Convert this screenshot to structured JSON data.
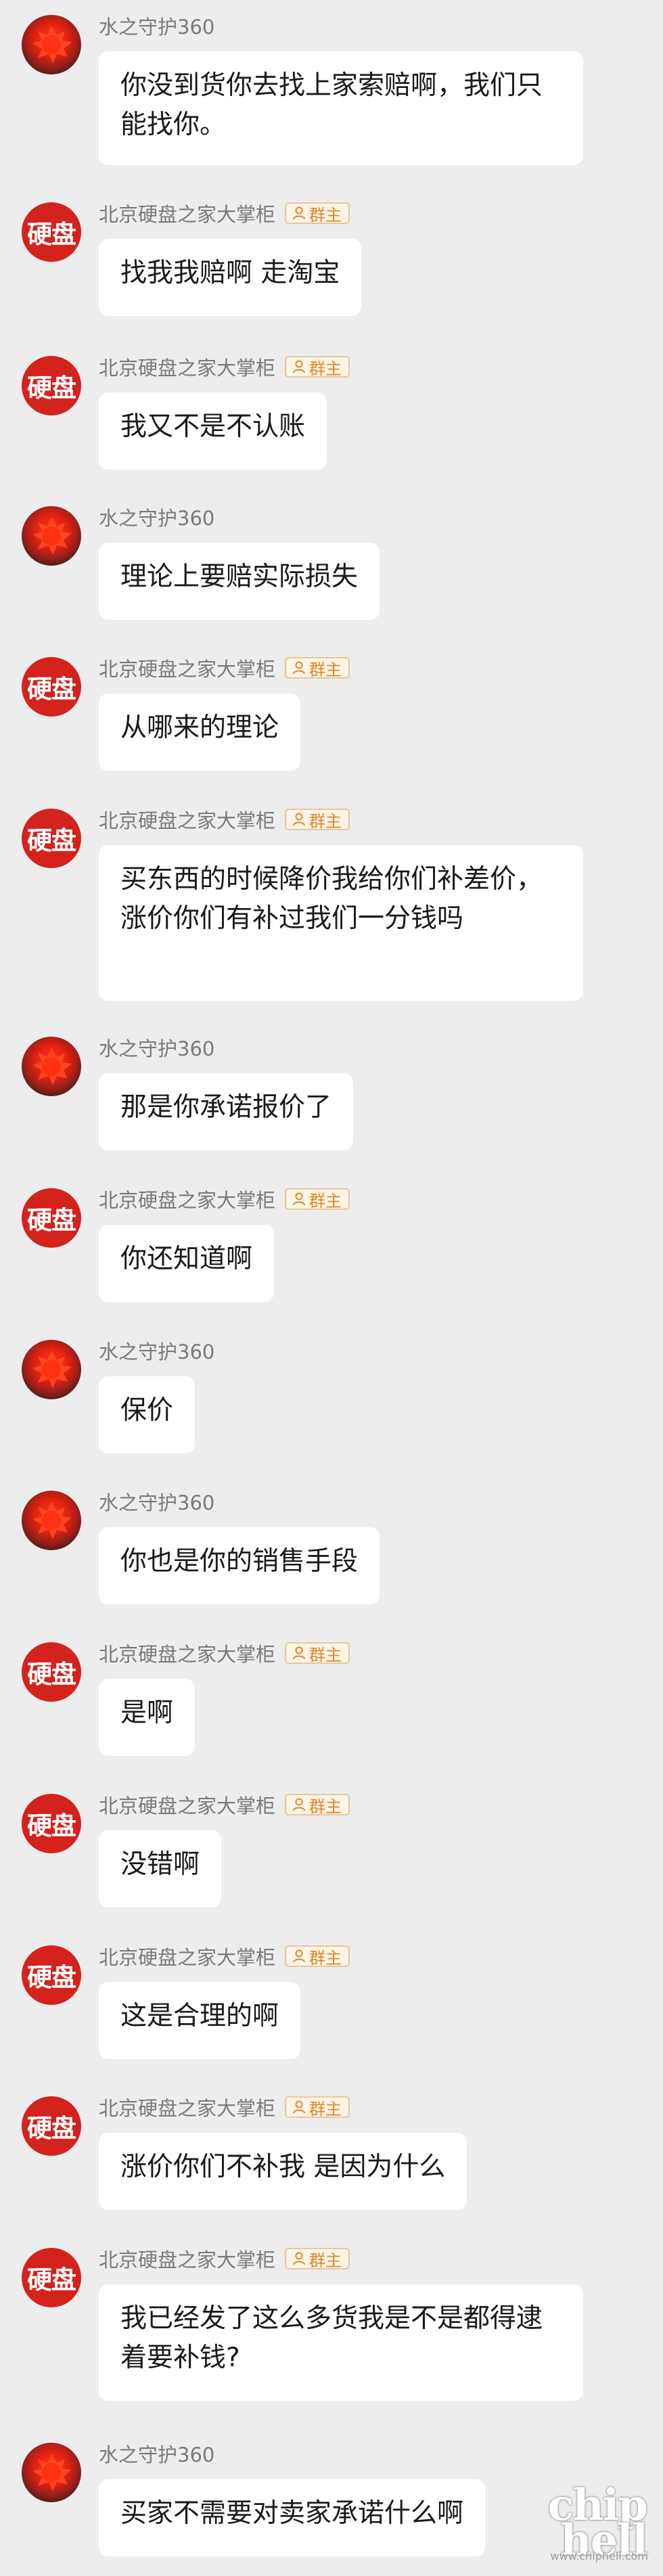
{
  "colors": {
    "background": "#ededed",
    "bubble": "#ffffff",
    "avatar_red": "#d4221d",
    "badge_text": "#d88a2b"
  },
  "users": {
    "water": {
      "name": "水之守护360",
      "avatar_icon": "red-leaf-avatar"
    },
    "disk": {
      "name": "北京硬盘之家大掌柜",
      "avatar_text": "硬盘",
      "badge": "群主",
      "badge_icon": "person-icon"
    }
  },
  "messages": [
    {
      "user": "water",
      "text": "你没到货你去找上家索赔啊，我们只能找你。"
    },
    {
      "user": "disk",
      "text": "找我我赔啊 走淘宝"
    },
    {
      "user": "disk",
      "text": "我又不是不认账"
    },
    {
      "user": "water",
      "text": "理论上要赔实际损失"
    },
    {
      "user": "disk",
      "text": "从哪来的理论"
    },
    {
      "user": "disk",
      "text": "买东西的时候降价我给你们补差价，涨价你们有补过我们一分钱吗"
    },
    {
      "user": "water",
      "text": "那是你承诺报价了"
    },
    {
      "user": "disk",
      "text": "你还知道啊"
    },
    {
      "user": "water",
      "text": "保价"
    },
    {
      "user": "water",
      "text": "你也是你的销售手段"
    },
    {
      "user": "disk",
      "text": "是啊"
    },
    {
      "user": "disk",
      "text": "没错啊"
    },
    {
      "user": "disk",
      "text": "这是合理的啊"
    },
    {
      "user": "disk",
      "text": "涨价你们不补我 是因为什么"
    },
    {
      "user": "disk",
      "text": "我已经发了这么多货我是不是都得逮着要补钱?"
    },
    {
      "user": "water",
      "text": "买家不需要对卖家承诺什么啊"
    }
  ],
  "watermark": {
    "logo": "chip hell",
    "url": "www.chiphell.com"
  }
}
